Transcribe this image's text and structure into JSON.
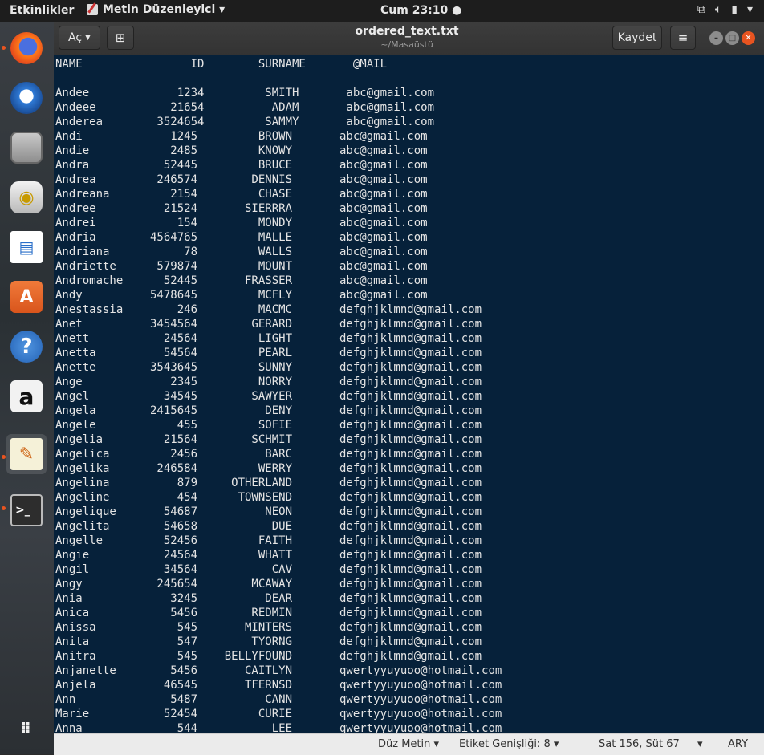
{
  "topbar": {
    "activities": "Etkinlikler",
    "app_menu": "Metin Düzenleyici ▾",
    "clock": "Cum 23:10 ●"
  },
  "dock": {
    "items": [
      "firefox-icon",
      "thunderbird-icon",
      "files-icon",
      "rhythmbox-icon",
      "writer-icon",
      "software-center-icon",
      "help-icon",
      "amazon-icon",
      "text-editor-icon",
      "terminal-icon"
    ]
  },
  "window": {
    "open_label": "Aç",
    "title": "ordered_text.txt",
    "subtitle": "~/Masaüstü",
    "save_label": "Kaydet"
  },
  "content": {
    "lines": [
      "NAME                ID        SURNAME       @MAIL",
      "",
      "Andee             1234         SMITH       abc@gmail.com",
      "Andeee           21654          ADAM       abc@gmail.com",
      "Anderea        3524654         SAMMY       abc@gmail.com",
      "Andi             1245         BROWN       abc@gmail.com",
      "Andie            2485         KNOWY       abc@gmail.com",
      "Andra           52445         BRUCE       abc@gmail.com",
      "Andrea         246574        DENNIS       abc@gmail.com",
      "Andreana         2154         CHASE       abc@gmail.com",
      "Andree          21524       SIERRRA       abc@gmail.com",
      "Andrei            154         MONDY       abc@gmail.com",
      "Andria        4564765         MALLE       abc@gmail.com",
      "Andriana           78         WALLS       abc@gmail.com",
      "Andriette      579874         MOUNT       abc@gmail.com",
      "Andromache      52445       FRASSER       abc@gmail.com",
      "Andy          5478645         MCFLY       abc@gmail.com",
      "Anestassia        246         MACMC       defghjklmnd@gmail.com",
      "Anet          3454564        GERARD       defghjklmnd@gmail.com",
      "Anett           24564         LIGHT       defghjklmnd@gmail.com",
      "Anetta          54564         PEARL       defghjklmnd@gmail.com",
      "Anette        3543645         SUNNY       defghjklmnd@gmail.com",
      "Ange             2345         NORRY       defghjklmnd@gmail.com",
      "Angel           34545        SAWYER       defghjklmnd@gmail.com",
      "Angela        2415645          DENY       defghjklmnd@gmail.com",
      "Angele            455         SOFIE       defghjklmnd@gmail.com",
      "Angelia         21564        SCHMIT       defghjklmnd@gmail.com",
      "Angelica         2456          BARC       defghjklmnd@gmail.com",
      "Angelika       246584         WERRY       defghjklmnd@gmail.com",
      "Angelina          879     OTHERLAND       defghjklmnd@gmail.com",
      "Angeline          454      TOWNSEND       defghjklmnd@gmail.com",
      "Angelique       54687          NEON       defghjklmnd@gmail.com",
      "Angelita        54658           DUE       defghjklmnd@gmail.com",
      "Angelle         52456         FAITH       defghjklmnd@gmail.com",
      "Angie           24564         WHATT       defghjklmnd@gmail.com",
      "Angil           34564           CAV       defghjklmnd@gmail.com",
      "Angy           245654        MCAWAY       defghjklmnd@gmail.com",
      "Ania             3245          DEAR       defghjklmnd@gmail.com",
      "Anica            5456        REDMIN       defghjklmnd@gmail.com",
      "Anissa            545       MINTERS       defghjklmnd@gmail.com",
      "Anita             547        TYORNG       defghjklmnd@gmail.com",
      "Anitra            545    BELLYFOUND       defghjklmnd@gmail.com",
      "Anjanette        5456       CAITLYN       qwertyyuyuoo@hotmail.com",
      "Anjela          46545       TFERNSD       qwertyyuyuoo@hotmail.com",
      "Ann              5487          CANN       qwertyyuyuoo@hotmail.com",
      "Marie           52454         CURIE       qwertyyuyuoo@hotmail.com",
      "Anna              544           LEE       qwertyyuyuoo@hotmail.com"
    ]
  },
  "statusbar": {
    "syntax": "Düz Metin ▾",
    "tab_width": "Etiket Genişliği: 8 ▾",
    "position": "Sat 156, Süt 67",
    "mode_arrow": "▾",
    "insert_mode": "ARY"
  }
}
